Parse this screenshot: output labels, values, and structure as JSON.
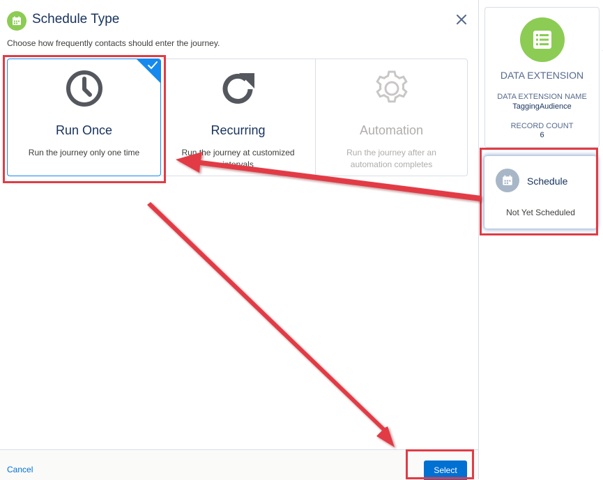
{
  "modal": {
    "title": "Schedule Type",
    "subtitle": "Choose how frequently contacts should enter the journey.",
    "close_icon": "close-icon",
    "header_icon": "calendar-icon"
  },
  "options": [
    {
      "name": "Run Once",
      "description": "Run the journey only one time",
      "icon": "clock-icon",
      "selected": true
    },
    {
      "name": "Recurring",
      "description": "Run the journey at customized intervals",
      "icon": "refresh-icon",
      "selected": false
    },
    {
      "name": "Automation",
      "description": "Run the journey after an automation completes",
      "icon": "gear-icon",
      "selected": false,
      "disabled": true
    }
  ],
  "footer": {
    "cancel_label": "Cancel",
    "select_label": "Select"
  },
  "data_extension": {
    "title": "DATA EXTENSION",
    "name_label": "DATA EXTENSION NAME",
    "name_value": "TaggingAudience",
    "count_label": "RECORD COUNT",
    "count_value": "6",
    "icon": "list-icon"
  },
  "schedule": {
    "title": "Schedule",
    "status": "Not Yet Scheduled",
    "icon": "calendar-icon"
  },
  "colors": {
    "accent": "#0070d2",
    "selected": "#1589ee",
    "green": "#8ccc54",
    "annotation": "#e03c45"
  }
}
